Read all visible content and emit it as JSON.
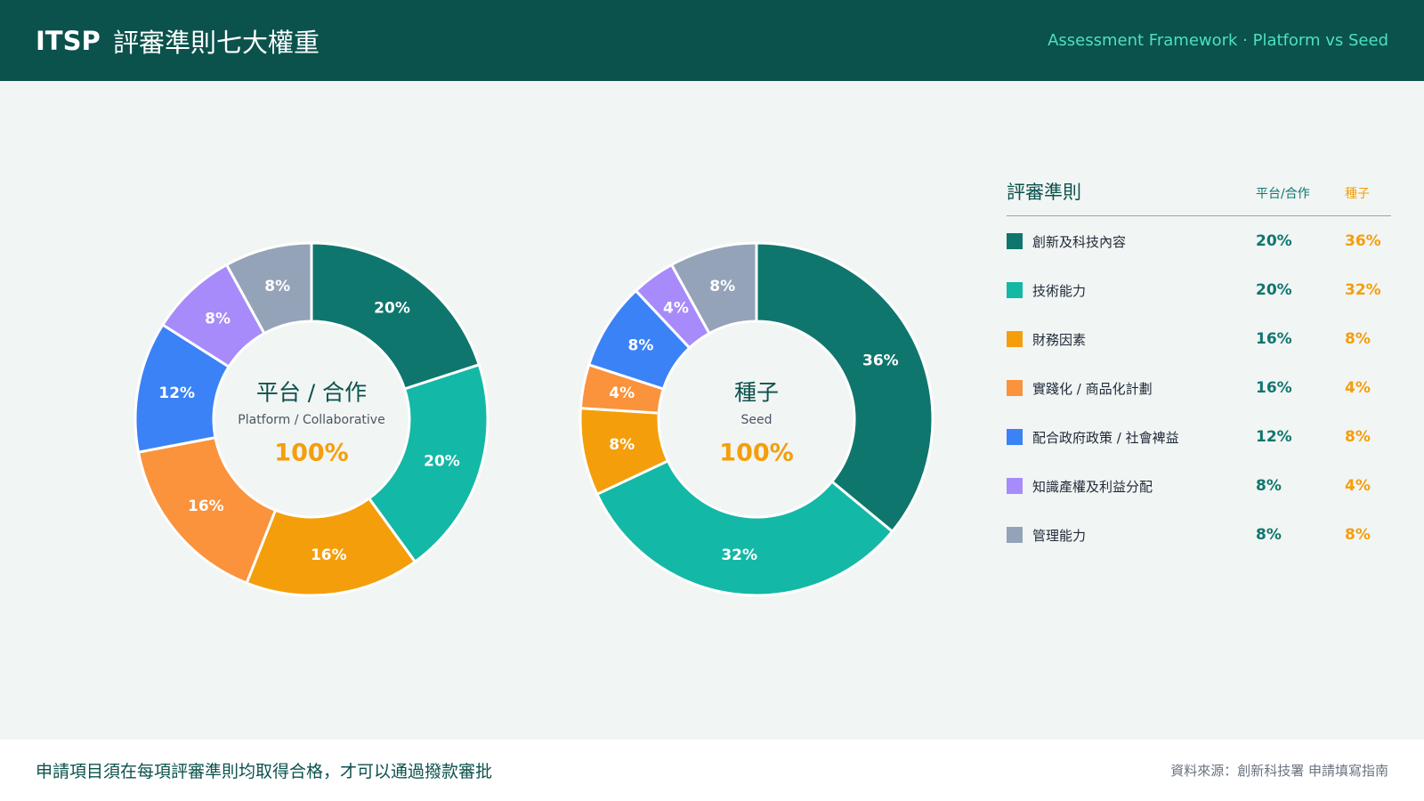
{
  "header": {
    "brand": "ITSP",
    "title": "評審準則七大權重",
    "subtitle": "Assessment Framework · Platform vs Seed"
  },
  "legend": {
    "title": "評審準則",
    "col_platform": "平台/合作",
    "col_seed": "種子"
  },
  "footer": {
    "note": "申請項目須在每項評審準則均取得合格，才可以通過撥款審批",
    "source": "資料來源：創新科技署 申請填寫指南"
  },
  "chart_data": [
    {
      "type": "pie",
      "donut": true,
      "center_title": "平台 / 合作",
      "center_subtitle": "Platform / Collaborative",
      "center_total": "100%",
      "categories": [
        "創新及科技內容",
        "技術能力",
        "財務因素",
        "實踐化 / 商品化計劃",
        "配合政府政策 / 社會裨益",
        "知識產權及利益分配",
        "管理能力"
      ],
      "values": [
        20,
        20,
        16,
        16,
        12,
        8,
        8
      ],
      "colors": [
        "#0f766e",
        "#14b8a6",
        "#f59e0b",
        "#fb923c",
        "#3b82f6",
        "#a78bfa",
        "#94a3b8"
      ],
      "labels": [
        "20%",
        "20%",
        "16%",
        "16%",
        "12%",
        "8%",
        "8%"
      ]
    },
    {
      "type": "pie",
      "donut": true,
      "center_title": "種子",
      "center_subtitle": "Seed",
      "center_total": "100%",
      "categories": [
        "創新及科技內容",
        "技術能力",
        "財務因素",
        "實踐化 / 商品化計劃",
        "配合政府政策 / 社會裨益",
        "知識產權及利益分配",
        "管理能力"
      ],
      "values": [
        36,
        32,
        8,
        4,
        8,
        4,
        8
      ],
      "colors": [
        "#0f766e",
        "#14b8a6",
        "#f59e0b",
        "#fb923c",
        "#3b82f6",
        "#a78bfa",
        "#94a3b8"
      ],
      "labels": [
        "36%",
        "32%",
        "8%",
        "4%",
        "8%",
        "4%",
        "8%"
      ]
    }
  ],
  "table": {
    "rows": [
      {
        "name": "創新及科技內容",
        "platform": "20%",
        "seed": "36%",
        "color": "#0f766e"
      },
      {
        "name": "技術能力",
        "platform": "20%",
        "seed": "32%",
        "color": "#14b8a6"
      },
      {
        "name": "財務因素",
        "platform": "16%",
        "seed": "8%",
        "color": "#f59e0b"
      },
      {
        "name": "實踐化 / 商品化計劃",
        "platform": "16%",
        "seed": "4%",
        "color": "#fb923c"
      },
      {
        "name": "配合政府政策 / 社會裨益",
        "platform": "12%",
        "seed": "8%",
        "color": "#3b82f6"
      },
      {
        "name": "知識產權及利益分配",
        "platform": "8%",
        "seed": "4%",
        "color": "#a78bfa"
      },
      {
        "name": "管理能力",
        "platform": "8%",
        "seed": "8%",
        "color": "#94a3b8"
      }
    ]
  }
}
